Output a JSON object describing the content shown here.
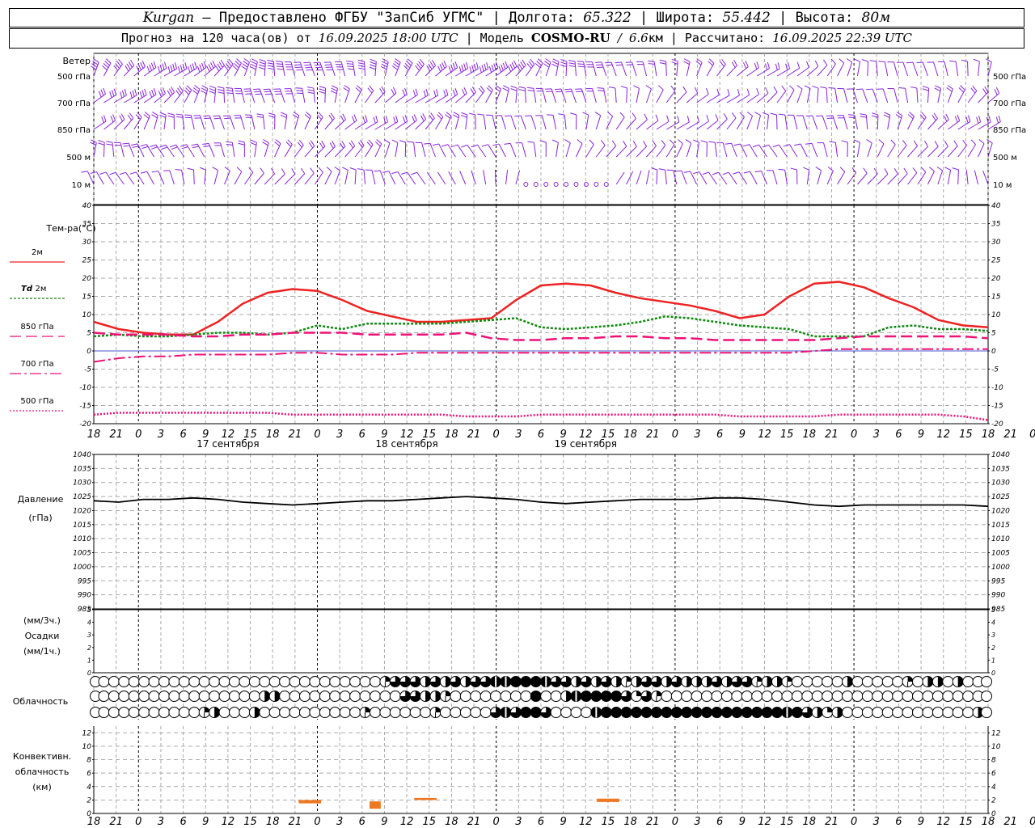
{
  "header": {
    "station": "Kurgan",
    "provider_sep": " — ",
    "provider": "Предоставлено ФГБУ \"ЗапСиб УГМС\"",
    "lon_label": "Долгота:",
    "lon_value": "65.322",
    "lat_label": "Широта:",
    "lat_value": "55.442",
    "alt_label": "Высота:",
    "alt_value": "80м",
    "forecast_label": "Прогноз на 120 часа(ов) от",
    "forecast_time": "16.09.2025 18:00 UTC",
    "model_label": "Модель",
    "model_name": "COSMO-RU",
    "model_res_value": "6.6",
    "model_res_unit": "км",
    "calc_label": "Рассчитано:",
    "calc_time": "16.09.2025 22:39 UTC",
    "sep": "|"
  },
  "chart_data": [
    {
      "type": "wind_barbs",
      "panel_label": "Ветер",
      "levels": [
        "500 гПа",
        "700 гПа",
        "850 гПа",
        "500 м",
        "10 м"
      ],
      "level_speed_ms": [
        [
          28,
          28,
          27,
          26,
          25,
          25,
          24,
          22,
          20,
          18,
          16,
          14,
          12,
          10,
          9,
          8,
          7,
          6,
          5,
          5,
          5
        ],
        [
          16,
          16,
          15,
          15,
          14,
          13,
          12,
          11,
          10,
          9,
          9,
          8,
          7,
          6,
          6,
          5,
          5,
          5,
          5,
          8,
          9
        ],
        [
          12,
          12,
          12,
          11,
          11,
          10,
          10,
          9,
          8,
          7,
          6,
          5,
          5,
          5,
          6,
          6,
          7,
          8,
          8,
          8,
          8
        ],
        [
          8,
          8,
          8,
          8,
          9,
          9,
          8,
          7,
          6,
          6,
          5,
          4,
          4,
          5,
          6,
          6,
          7,
          7,
          7,
          7,
          6
        ],
        [
          3,
          3,
          3,
          3,
          4,
          4,
          3,
          3,
          2,
          2,
          1,
          1,
          2,
          3,
          3,
          3,
          3,
          3,
          3,
          3,
          2
        ]
      ]
    },
    {
      "type": "line",
      "panel_label": "Тем-ра(°C)",
      "ylim": [
        -20,
        40
      ],
      "yticks": [
        -20,
        -15,
        -10,
        -5,
        0,
        5,
        10,
        15,
        20,
        25,
        30,
        35,
        40
      ],
      "x_hours": [
        0,
        3,
        6,
        9,
        12,
        15,
        18,
        21,
        24,
        27,
        30,
        33,
        36,
        39,
        42,
        45,
        48,
        51,
        54,
        57,
        60,
        63,
        66,
        69,
        72,
        75,
        78,
        81,
        84,
        87,
        90,
        93,
        96,
        99,
        102,
        105,
        108,
        111,
        114,
        117,
        120
      ],
      "series": [
        {
          "name": "2м",
          "color": "#ee2222",
          "dash": "",
          "width": 2.5,
          "values": [
            8,
            6,
            5,
            4.5,
            4.5,
            8,
            13,
            16,
            17,
            16.5,
            14,
            11,
            9.5,
            8,
            8,
            8.5,
            9,
            14,
            18,
            18.5,
            18,
            16,
            14.5,
            13.5,
            12.5,
            11,
            9,
            10,
            15,
            18.5,
            19,
            17.5,
            14.5,
            12,
            8.5,
            7,
            6.5
          ]
        },
        {
          "name": "Td 2м",
          "name_prefix": "Td",
          "name_suffix": "2м",
          "color": "#118811",
          "dash": "3,2",
          "width": 2.5,
          "values": [
            4,
            4.5,
            4,
            4,
            4.5,
            5,
            5,
            4.5,
            5,
            7,
            6,
            7.5,
            7.5,
            7.5,
            7.5,
            8,
            8.5,
            9,
            6.5,
            6,
            6.5,
            7,
            8,
            9.5,
            9,
            8,
            7,
            6.5,
            6,
            4,
            4,
            4,
            6.5,
            7,
            6,
            6,
            5.5
          ]
        },
        {
          "name": "850 гПа",
          "color": "#ee1177",
          "dash": "14,6",
          "width": 2.5,
          "values": [
            5,
            4.5,
            4.5,
            4.5,
            4,
            4,
            4.5,
            4.5,
            5,
            5,
            5,
            4.5,
            4.5,
            4.5,
            4.5,
            5,
            3.5,
            3,
            3,
            3.5,
            3.5,
            4,
            4,
            3.5,
            3.5,
            3,
            3,
            3,
            3,
            3,
            3.5,
            4,
            4,
            4,
            4,
            4,
            3.5
          ]
        },
        {
          "name": "700 гПа",
          "color": "#ee1177",
          "dash": "14,4,3,4",
          "width": 2,
          "values": [
            -3,
            -2,
            -1.5,
            -1.5,
            -1,
            -1,
            -1,
            -1,
            -0.5,
            -0.5,
            -1,
            -1,
            -1,
            -0.5,
            -0.5,
            -0.5,
            -0.5,
            -0.5,
            -0.5,
            -0.5,
            -0.5,
            -0.5,
            -0.5,
            -0.5,
            -0.5,
            -0.5,
            -0.5,
            -0.5,
            -0.5,
            0,
            0.5,
            0.5,
            0.5,
            0.5,
            0.5,
            0.5,
            0.5
          ]
        },
        {
          "name": "500 гПа",
          "color": "#ee1177",
          "dash": "2,2",
          "width": 2.5,
          "values": [
            -17.5,
            -17,
            -17,
            -17,
            -17,
            -17,
            -17,
            -17,
            -17.5,
            -17.5,
            -17.5,
            -17.5,
            -17.5,
            -17.5,
            -17.5,
            -18,
            -18,
            -18,
            -17.5,
            -17.5,
            -17.5,
            -17.5,
            -17.5,
            -17.5,
            -17.5,
            -17.5,
            -18,
            -18,
            -18,
            -18,
            -17.5,
            -17.5,
            -17.5,
            -17.5,
            -17.5,
            -18,
            -19
          ]
        }
      ]
    },
    {
      "type": "line",
      "panel_label": "Давление",
      "panel_unit": "(гПа)",
      "ylim": [
        985,
        1040
      ],
      "yticks": [
        985,
        990,
        995,
        1000,
        1005,
        1010,
        1015,
        1020,
        1025,
        1030,
        1035,
        1040
      ],
      "series": [
        {
          "name": "",
          "color": "#000000",
          "values": [
            1023.5,
            1023,
            1024,
            1024,
            1024.5,
            1024,
            1023,
            1022.5,
            1022,
            1022.5,
            1023,
            1023.5,
            1023.5,
            1024,
            1024.5,
            1025,
            1024.5,
            1024,
            1023,
            1022.5,
            1023,
            1023.5,
            1024,
            1024,
            1024,
            1024.5,
            1024.5,
            1024,
            1023,
            1022,
            1021.5,
            1022,
            1022,
            1022,
            1022,
            1022,
            1021.5
          ]
        }
      ]
    },
    {
      "type": "bar",
      "panel_label": "Осадки",
      "panel_unit_top": "(мм/3ч.)",
      "panel_unit_bottom": "(мм/1ч.)",
      "ylim": [
        0,
        5
      ],
      "yticks": [
        0,
        1,
        2,
        3,
        4,
        5
      ],
      "values": []
    },
    {
      "type": "cloud_symbols",
      "panel_label": "Облачность",
      "levels": [
        "high",
        "middle",
        "low"
      ],
      "oktas": [
        [
          0,
          0,
          0,
          0,
          0,
          0,
          0,
          0,
          0,
          0,
          0,
          0,
          0,
          0,
          0,
          0,
          0,
          0,
          0,
          0,
          0,
          0,
          0,
          0,
          0,
          0,
          0,
          0,
          0,
          3,
          6,
          6,
          6,
          4,
          5,
          4,
          6,
          4,
          6,
          5,
          7,
          7,
          8,
          8,
          8,
          7,
          6,
          6,
          4,
          6,
          4,
          6,
          4,
          3,
          4,
          6,
          6,
          4,
          5,
          4,
          4,
          4,
          6,
          4,
          5,
          6,
          3,
          4,
          4,
          3,
          0,
          0,
          0,
          0,
          0,
          4,
          0,
          0,
          0,
          0,
          0,
          3,
          0,
          4,
          4,
          0,
          4,
          0,
          0,
          0
        ],
        [
          0,
          0,
          0,
          0,
          0,
          0,
          0,
          0,
          0,
          0,
          0,
          0,
          0,
          0,
          0,
          0,
          0,
          4,
          4,
          0,
          0,
          0,
          0,
          0,
          0,
          0,
          0,
          0,
          0,
          0,
          0,
          6,
          5,
          4,
          4,
          3,
          0,
          0,
          0,
          0,
          0,
          0,
          0,
          0,
          8,
          0,
          0,
          4,
          7,
          8,
          8,
          8,
          8,
          5,
          2,
          6,
          3,
          0,
          0,
          0,
          0,
          0,
          0,
          0,
          0,
          0,
          0,
          0,
          0,
          0,
          0,
          0,
          0,
          0,
          0,
          0,
          0,
          0,
          0,
          0,
          0,
          0,
          0,
          0,
          0,
          0,
          0,
          0,
          0,
          0
        ],
        [
          0,
          0,
          0,
          0,
          0,
          0,
          0,
          0,
          0,
          0,
          0,
          3,
          4,
          0,
          0,
          0,
          4,
          0,
          0,
          0,
          0,
          0,
          0,
          0,
          0,
          0,
          0,
          3,
          0,
          0,
          0,
          0,
          0,
          0,
          3,
          0,
          0,
          0,
          0,
          0,
          5,
          7,
          6,
          8,
          8,
          6,
          0,
          0,
          0,
          0,
          7,
          8,
          8,
          8,
          8,
          8,
          8,
          8,
          8,
          8,
          8,
          8,
          8,
          8,
          8,
          8,
          8,
          8,
          8,
          7,
          8,
          6,
          4,
          2,
          4,
          0,
          0,
          0,
          0,
          0,
          0,
          0,
          0,
          0,
          0,
          0,
          0,
          0,
          4,
          0
        ]
      ]
    },
    {
      "type": "bar",
      "panel_label_lines": [
        "Конвективн.",
        "облачность",
        "(км)"
      ],
      "ylim": [
        0,
        13
      ],
      "yticks": [
        0,
        2,
        4,
        6,
        8,
        10,
        12
      ],
      "color": "#ee7722",
      "segments": [
        {
          "start_hour": 27.5,
          "end_hour": 30.5,
          "base_km": 1.5,
          "top_km": 2.0
        },
        {
          "start_hour": 37,
          "end_hour": 38.5,
          "base_km": 0.7,
          "top_km": 1.8
        },
        {
          "start_hour": 43,
          "end_hour": 46,
          "base_km": 2.0,
          "top_km": 2.3
        },
        {
          "start_hour": 67.5,
          "end_hour": 70.5,
          "base_km": 1.7,
          "top_km": 2.2
        }
      ]
    }
  ],
  "x_axis": {
    "start_hour_utc": 18,
    "tick_labels": [
      "18",
      "21",
      "0",
      "3",
      "6",
      "9",
      "12",
      "15",
      "18",
      "21",
      "0",
      "3",
      "6",
      "9",
      "12",
      "15",
      "18",
      "21",
      "0",
      "3",
      "6",
      "9",
      "12",
      "15",
      "18",
      "21",
      "0",
      "3",
      "6",
      "9",
      "12",
      "15",
      "18",
      "21",
      "0",
      "3",
      "6",
      "9",
      "12",
      "15",
      "18",
      "21",
      "0"
    ],
    "day_labels": [
      "17 сентября",
      "18 сентября",
      "19 сентября"
    ]
  },
  "colors": {
    "wind": "#8822dd",
    "grid": "#aaaaaa",
    "frame": "#000000"
  }
}
